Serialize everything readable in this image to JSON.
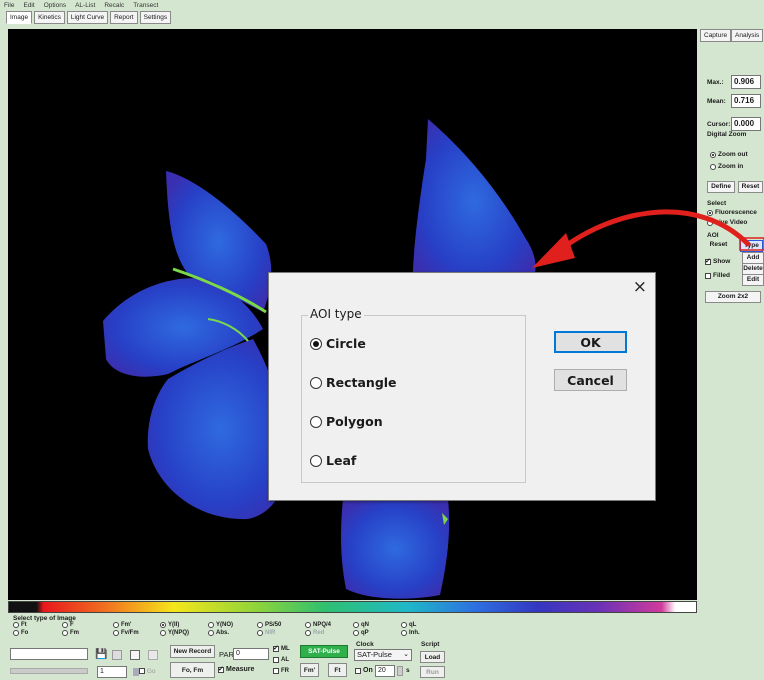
{
  "menu": [
    "File",
    "Edit",
    "Options",
    "AL-List",
    "Recalc",
    "Transect"
  ],
  "tabs": [
    "Image",
    "Kinetics",
    "Light Curve",
    "Report",
    "Settings"
  ],
  "right_panel": {
    "tabs": [
      "Capture",
      "Analysis"
    ],
    "max_label": "Max.:",
    "max_value": "0.906",
    "mean_label": "Mean:",
    "mean_value": "0.716",
    "cursor_label": "Cursor:",
    "cursor_value": "0.000",
    "digital_zoom": "Digital Zoom",
    "zoom_out": "Zoom out",
    "zoom_in": "Zoom in",
    "define": "Define",
    "reset": "Reset",
    "select": "Select",
    "fluorescence": "Fluorescence",
    "live_video": "Live Video",
    "aoi": "AOI",
    "aoi_reset": "Reset",
    "aoi_type": "Type",
    "show": "Show",
    "filled": "Filled",
    "add": "Add",
    "delete": "Delete",
    "edit": "Edit",
    "zoom2x2": "Zoom 2x2"
  },
  "bottom_panel": {
    "select_type": "Select type of Image",
    "radios": [
      "Ft",
      "F",
      "Fm'",
      "Y(II)",
      "Y(NO)",
      "PS/50",
      "NPQ/4",
      "qN",
      "qL",
      "Fo",
      "Fm",
      "Fv/Fm",
      "Y(NPQ)",
      "Abs.",
      "NIR",
      "Red",
      "qP",
      "Inh."
    ],
    "new_record": "New Record",
    "fo_fm": "Fo, Fm",
    "par_label": "PAR",
    "par_value": "0",
    "ml": "ML",
    "al": "AL",
    "fr": "FR",
    "measure": "Measure",
    "sat_pulse_button": "SAT-Pulse",
    "clock": "Clock",
    "clock_select": "SAT-Pulse",
    "fm_prime": "Fm'",
    "ft": "Ft",
    "on": "On",
    "interval": "20",
    "seconds": "s",
    "script": "Script",
    "load": "Load",
    "run": "Run",
    "record_value": "1",
    "go": "Go"
  },
  "dialog": {
    "close": "×",
    "group_title": "AOI type",
    "options": [
      "Circle",
      "Rectangle",
      "Polygon",
      "Leaf"
    ],
    "selected": "Circle",
    "ok": "OK",
    "cancel": "Cancel"
  },
  "colors": {
    "background": "#d4e6cf",
    "leaf": "#2a4fd0",
    "arrow": "#e0201c",
    "dialog_default_border": "#0078d7"
  }
}
